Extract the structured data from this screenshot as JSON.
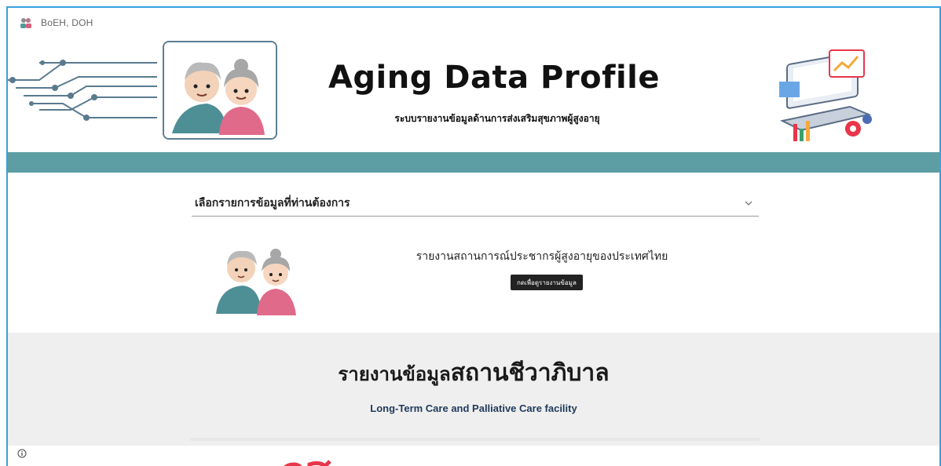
{
  "site": {
    "name": "BoEH, DOH"
  },
  "header": {
    "title": "Aging Data Profile",
    "subtitle": "ระบบรายงานข้อมูลด้านการส่งเสริมสุขภาพผู้สูงอายุ"
  },
  "selector": {
    "label": "เลือกรายการข้อมูลที่ท่านต้องการ"
  },
  "report": {
    "text": "รายงานสถานการณ์ประชากรผู้สูงอายุของประเทศไทย",
    "button_label": "กดเพื่อดูรายงานข้อมูล"
  },
  "hospice": {
    "title_prefix": "รายงานข้อมูล",
    "title_main": "สถานชีวาภิบาล",
    "subtitle": "Long-Term Care and Palliative Care facility"
  },
  "colors": {
    "teal_bar": "#5d9ea4",
    "accent_border": "#3aa0e0",
    "gray_section": "#efefef",
    "button_bg": "#222222",
    "red_heading": "#e8364a"
  },
  "icons": {
    "site_logo": "elders-icon",
    "dropdown": "chevron-down-icon",
    "info": "info-icon"
  }
}
